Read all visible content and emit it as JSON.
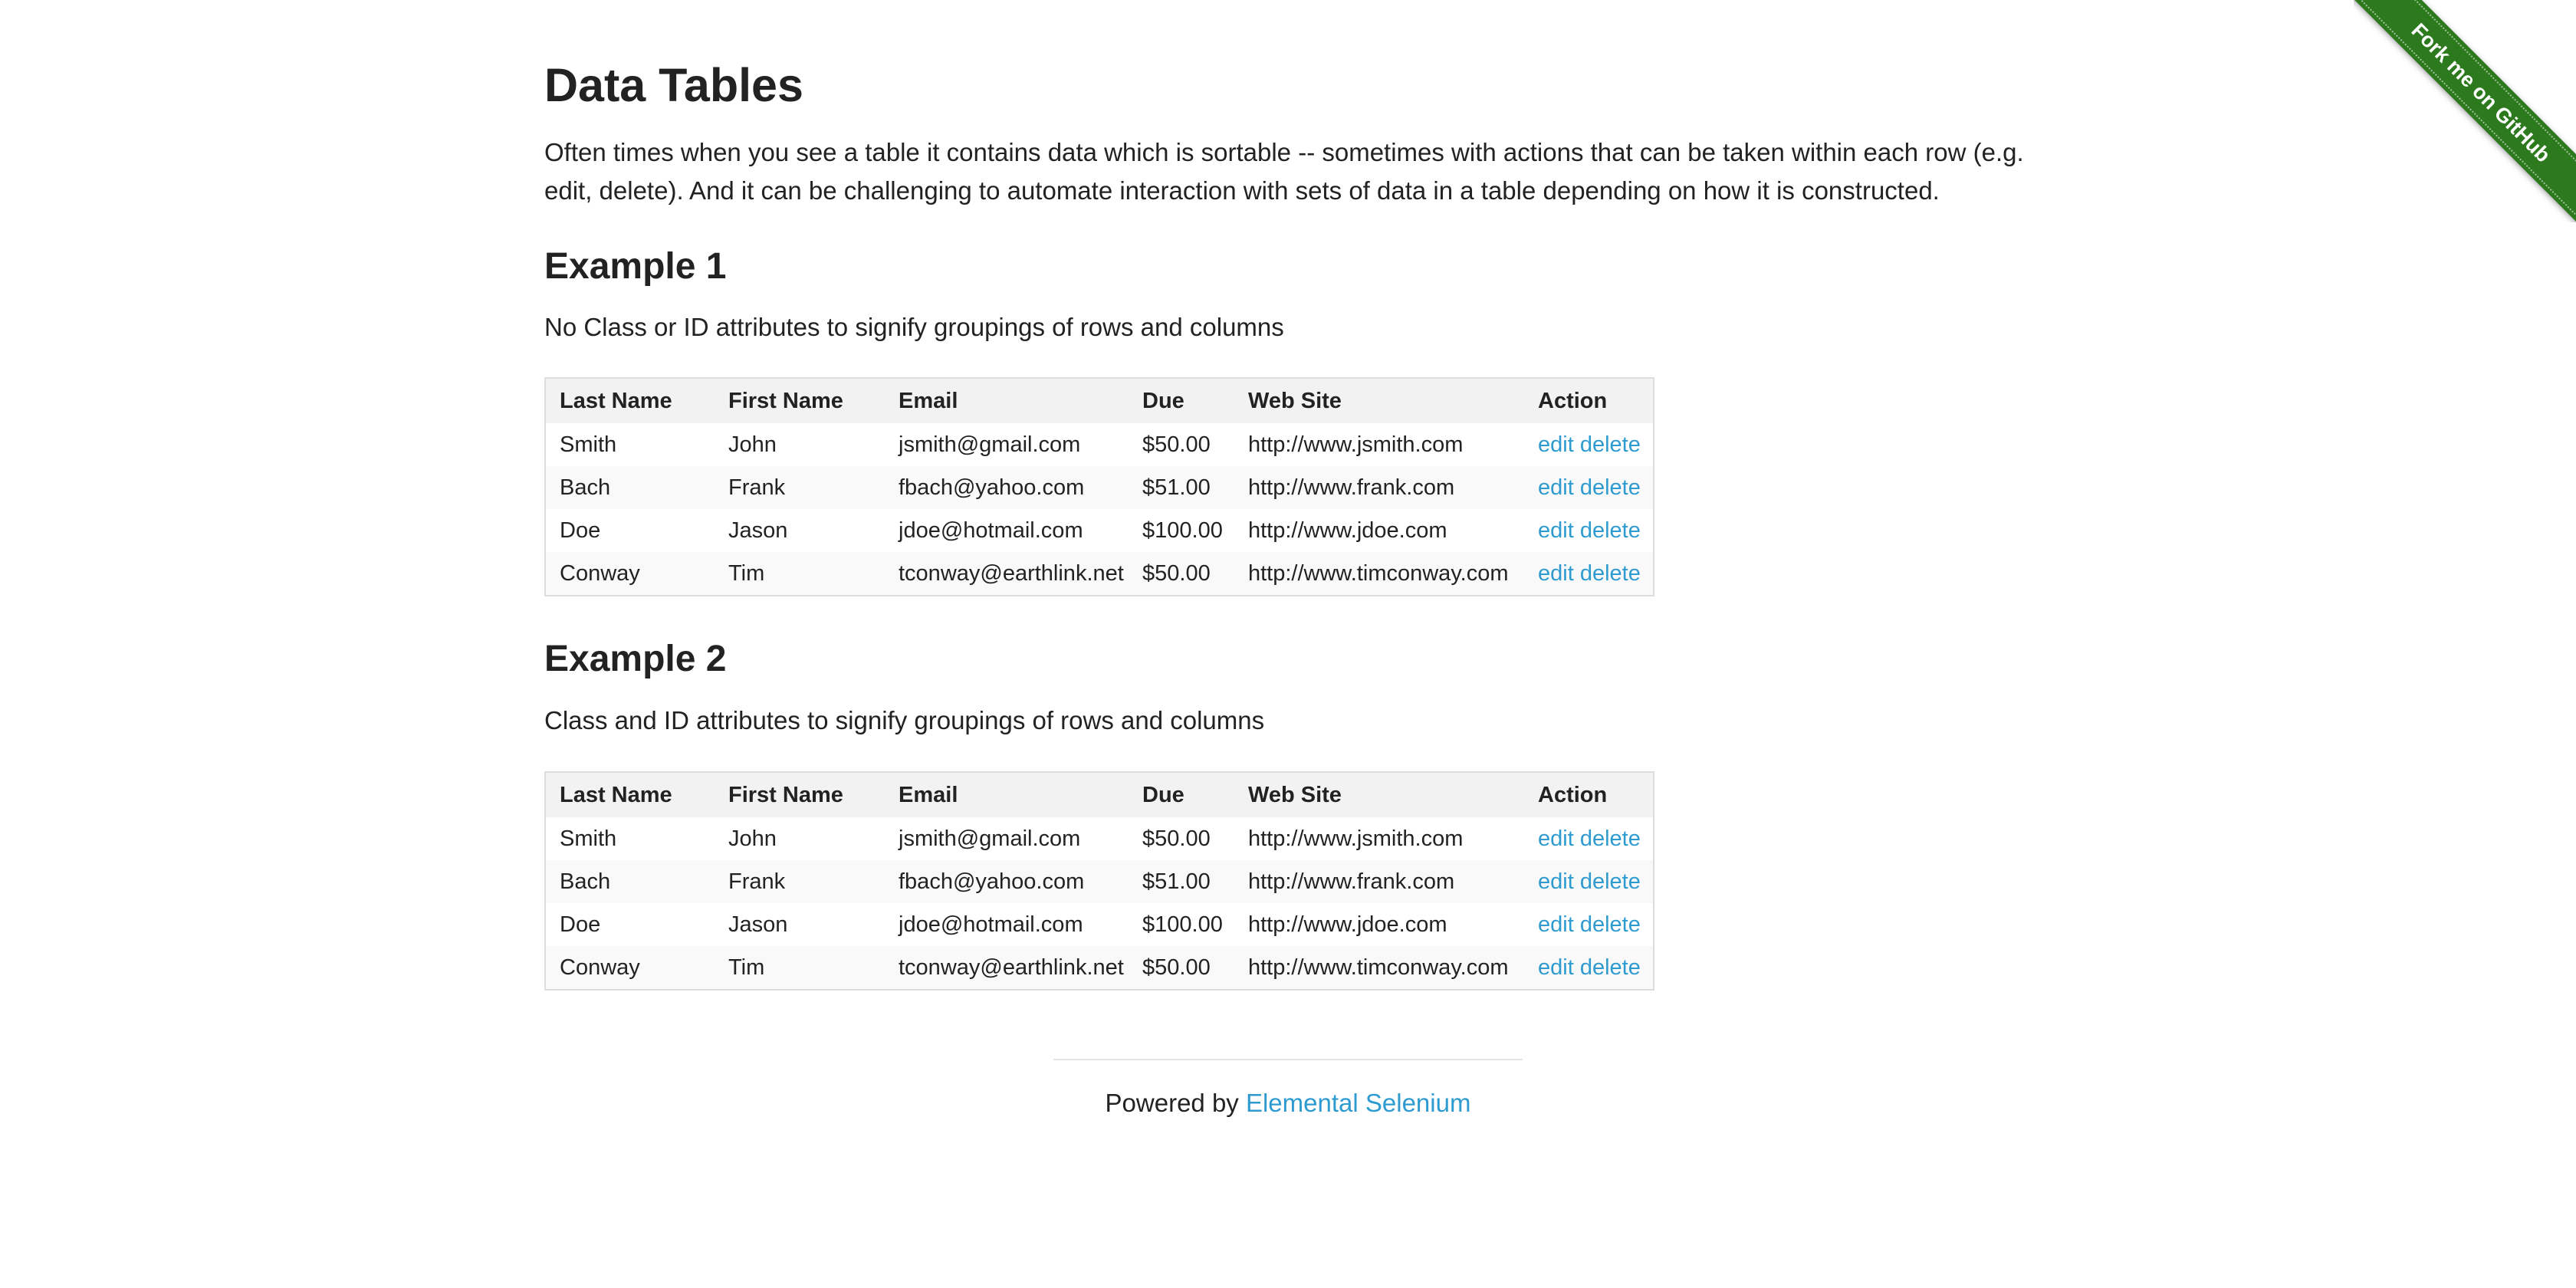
{
  "page": {
    "title": "Data Tables",
    "intro": "Often times when you see a table it contains data which is sortable -- sometimes with actions that can be taken within each row (e.g. edit, delete). And it can be challenging to automate interaction with sets of data in a table depending on how it is constructed."
  },
  "ribbon": {
    "label": "Fork me on GitHub"
  },
  "columns": [
    "Last Name",
    "First Name",
    "Email",
    "Due",
    "Web Site",
    "Action"
  ],
  "example1": {
    "heading": "Example 1",
    "description": "No Class or ID attributes to signify groupings of rows and columns",
    "rows": [
      {
        "last": "Smith",
        "first": "John",
        "email": "jsmith@gmail.com",
        "due": "$50.00",
        "web": "http://www.jsmith.com",
        "edit": "edit",
        "delete": "delete"
      },
      {
        "last": "Bach",
        "first": "Frank",
        "email": "fbach@yahoo.com",
        "due": "$51.00",
        "web": "http://www.frank.com",
        "edit": "edit",
        "delete": "delete"
      },
      {
        "last": "Doe",
        "first": "Jason",
        "email": "jdoe@hotmail.com",
        "due": "$100.00",
        "web": "http://www.jdoe.com",
        "edit": "edit",
        "delete": "delete"
      },
      {
        "last": "Conway",
        "first": "Tim",
        "email": "tconway@earthlink.net",
        "due": "$50.00",
        "web": "http://www.timconway.com",
        "edit": "edit",
        "delete": "delete"
      }
    ]
  },
  "example2": {
    "heading": "Example 2",
    "description": "Class and ID attributes to signify groupings of rows and columns",
    "rows": [
      {
        "last": "Smith",
        "first": "John",
        "email": "jsmith@gmail.com",
        "due": "$50.00",
        "web": "http://www.jsmith.com",
        "edit": "edit",
        "delete": "delete"
      },
      {
        "last": "Bach",
        "first": "Frank",
        "email": "fbach@yahoo.com",
        "due": "$51.00",
        "web": "http://www.frank.com",
        "edit": "edit",
        "delete": "delete"
      },
      {
        "last": "Doe",
        "first": "Jason",
        "email": "jdoe@hotmail.com",
        "due": "$100.00",
        "web": "http://www.jdoe.com",
        "edit": "edit",
        "delete": "delete"
      },
      {
        "last": "Conway",
        "first": "Tim",
        "email": "tconway@earthlink.net",
        "due": "$50.00",
        "web": "http://www.timconway.com",
        "edit": "edit",
        "delete": "delete"
      }
    ]
  },
  "footer": {
    "prefix": "Powered by",
    "link": "Elemental Selenium"
  },
  "colors": {
    "link": "#2e9bd0",
    "ribbon": "#2c7a1d",
    "text": "#222222"
  }
}
